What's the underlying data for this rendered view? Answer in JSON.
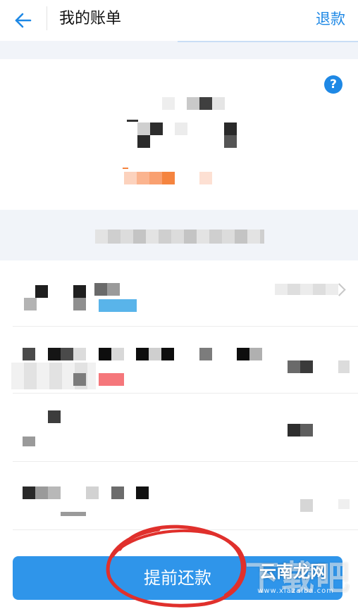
{
  "header": {
    "title": "我的账单",
    "refund_label": "退款",
    "help_label": "?"
  },
  "footer": {
    "prepay_label": "提前还款"
  },
  "watermark": {
    "big": "下载吧",
    "cn": "云南龙网",
    "url": "www.xiazaiba.com"
  },
  "colors": {
    "accent": "#1e88e5",
    "button": "#2f95ea",
    "annotation": "#e0302c"
  },
  "icons": {
    "back": "arrow-left-icon",
    "help": "question-circle-icon",
    "chevron": "chevron-right-icon"
  }
}
